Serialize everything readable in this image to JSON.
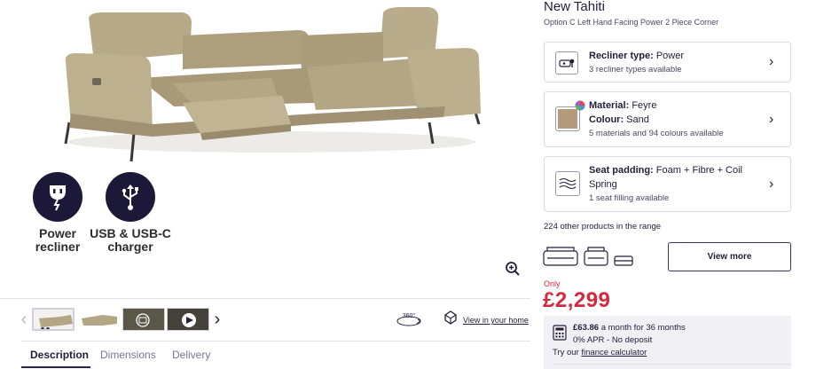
{
  "product": {
    "title": "New Tahiti",
    "subtitle": "Option C Left Hand Facing Power 2 Piece Corner"
  },
  "features": [
    {
      "label_line1": "Power",
      "label_line2": "recliner",
      "icon": "power-plug-icon"
    },
    {
      "label_line1": "USB & USB-C",
      "label_line2": "charger",
      "icon": "usb-icon"
    }
  ],
  "gallery": {
    "view_in_home": "View in your home",
    "badge_360": "360°"
  },
  "tabs": [
    "Description",
    "Dimensions",
    "Delivery"
  ],
  "options": {
    "recliner": {
      "label": "Recliner type:",
      "value": "Power",
      "meta": "3 recliner types available"
    },
    "material": {
      "label": "Material:",
      "value": "Feyre",
      "colour_label": "Colour:",
      "colour_value": "Sand",
      "meta": "5 materials and 94 colours available",
      "swatch": "#b39a7b"
    },
    "seat": {
      "label": "Seat padding:",
      "value": "Foam + Fibre + Coil Spring",
      "meta": "1 seat filling available"
    }
  },
  "range": {
    "text": "224 other products in the range",
    "view_more": "View more"
  },
  "pricing": {
    "only": "Only",
    "price": "£2,299",
    "monthly_amount": "£63.86",
    "monthly_text": "a month for 36 months",
    "apr": "0% APR - No deposit",
    "try_our": "Try our",
    "calc_link": "finance calculator"
  },
  "colors": {
    "brand_dark": "#1c1838",
    "price_red": "#d6283f",
    "sofa": "#b3a684"
  }
}
